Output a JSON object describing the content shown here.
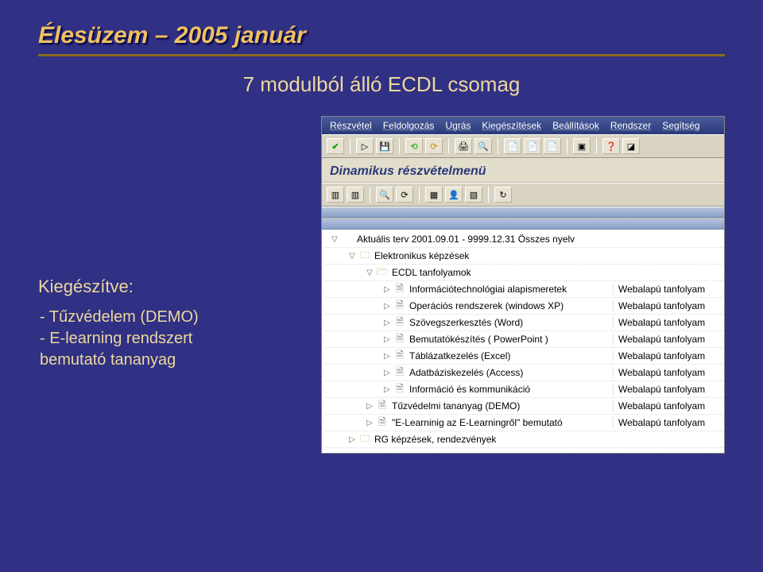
{
  "title": "Élesüzem – 2005 január",
  "subtitle": "7 modulból álló ECDL csomag",
  "left": {
    "heading": "Kiegészítve:",
    "items": [
      "- Tűzvédelem (DEMO)",
      "- E-learning rendszert",
      "  bemutató tananyag"
    ]
  },
  "app": {
    "menu": [
      "Részvétel",
      "Feldolgozás",
      "Ugrás",
      "Kiegészítések",
      "Beállítások",
      "Rendszer",
      "Segítség"
    ],
    "dyn_title": "Dinamikus részvételmenü",
    "webcourse": "Webalapú tanfolyam",
    "tree": [
      {
        "lvl": 0,
        "tw": "down",
        "icon": "none",
        "label": "Aktuális terv 2001.09.01 - 9999.12.31 Összes nyelv",
        "col2": ""
      },
      {
        "lvl": 1,
        "tw": "down",
        "icon": "folder",
        "label": "Elektronikus képzések",
        "col2": ""
      },
      {
        "lvl": 2,
        "tw": "down",
        "icon": "folder-open",
        "label": "ECDL tanfolyamok",
        "col2": ""
      },
      {
        "lvl": 3,
        "tw": "right",
        "icon": "doc",
        "label": "Információtechnológiai alapismeretek",
        "col2": "web"
      },
      {
        "lvl": 3,
        "tw": "right",
        "icon": "doc",
        "label": "Operációs rendszerek (windows XP)",
        "col2": "web"
      },
      {
        "lvl": 3,
        "tw": "right",
        "icon": "doc",
        "label": "Szövegszerkesztés (Word)",
        "col2": "web"
      },
      {
        "lvl": 3,
        "tw": "right",
        "icon": "doc",
        "label": "Bemutatókészítés ( PowerPoint )",
        "col2": "web"
      },
      {
        "lvl": 3,
        "tw": "right",
        "icon": "doc",
        "label": "Táblázatkezelés (Excel)",
        "col2": "web"
      },
      {
        "lvl": 3,
        "tw": "right",
        "icon": "doc",
        "label": "Adatbáziskezelés (Access)",
        "col2": "web"
      },
      {
        "lvl": 3,
        "tw": "right",
        "icon": "doc",
        "label": "Információ és kommunikáció",
        "col2": "web"
      },
      {
        "lvl": 2,
        "tw": "right",
        "icon": "doc",
        "label": "Tűzvédelmi tananyag (DEMO)",
        "col2": "web"
      },
      {
        "lvl": 2,
        "tw": "right",
        "icon": "doc",
        "label": "\"E-Learninig az E-Learningről\" bemutató",
        "col2": "web"
      },
      {
        "lvl": 1,
        "tw": "right",
        "icon": "folder",
        "label": "RG képzések, rendezvények",
        "col2": ""
      }
    ]
  }
}
